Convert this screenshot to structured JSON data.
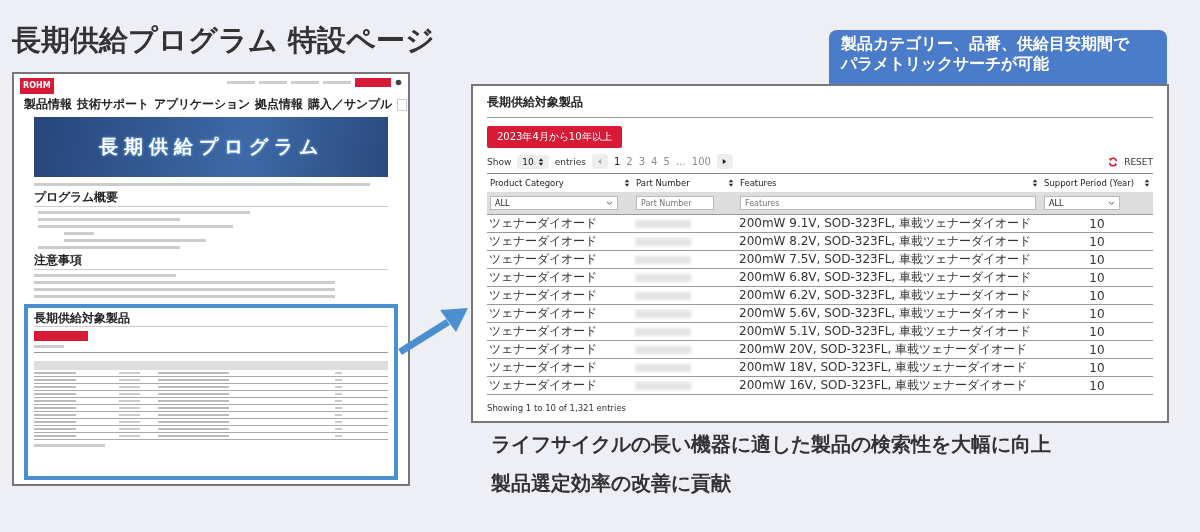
{
  "page_title": "長期供給プログラム 特設ページ",
  "callout": [
    "製品カテゴリー、品番、供給目安期間で",
    "パラメトリックサーチが可能"
  ],
  "thumbnail": {
    "logo": "ROHM",
    "nav": [
      "製品情報",
      "技術サポート",
      "アプリケーション",
      "拠点情報",
      "購入／サンプル"
    ],
    "banner_title": "長期供給プログラム",
    "headings": [
      "プログラム概要",
      "注意事項"
    ],
    "section_title": "長期供給対象製品"
  },
  "panel": {
    "title": "長期供給対象製品",
    "filter_button": "2023年4月から10年以上",
    "show_label": "Show",
    "page_size": "10",
    "entries_label": "entries",
    "pages": [
      {
        "label": "1",
        "selected": true
      },
      {
        "label": "2",
        "selected": false
      },
      {
        "label": "3",
        "selected": false
      },
      {
        "label": "4",
        "selected": false
      },
      {
        "label": "5",
        "selected": false
      },
      {
        "label": "…",
        "selected": false
      },
      {
        "label": "100",
        "selected": false
      }
    ],
    "reset": "RESET",
    "columns": [
      "Product Category",
      "Part Number",
      "Features",
      "Support Period (Year)"
    ],
    "filters": {
      "category": "ALL",
      "part_placeholder": "Part Number",
      "features_placeholder": "Features",
      "period": "ALL"
    },
    "rows": [
      {
        "category": "ツェナーダイオード",
        "features": "200mW 9.1V, SOD-323FL, 車載ツェナーダイオード",
        "period": "10"
      },
      {
        "category": "ツェナーダイオード",
        "features": "200mW 8.2V, SOD-323FL, 車載ツェナーダイオード",
        "period": "10"
      },
      {
        "category": "ツェナーダイオード",
        "features": "200mW 7.5V, SOD-323FL, 車載ツェナーダイオード",
        "period": "10"
      },
      {
        "category": "ツェナーダイオード",
        "features": "200mW 6.8V, SOD-323FL, 車載ツェナーダイオード",
        "period": "10"
      },
      {
        "category": "ツェナーダイオード",
        "features": "200mW 6.2V, SOD-323FL, 車載ツェナーダイオード",
        "period": "10"
      },
      {
        "category": "ツェナーダイオード",
        "features": "200mW 5.6V, SOD-323FL, 車載ツェナーダイオード",
        "period": "10"
      },
      {
        "category": "ツェナーダイオード",
        "features": "200mW 5.1V, SOD-323FL, 車載ツェナーダイオード",
        "period": "10"
      },
      {
        "category": "ツェナーダイオード",
        "features": "200mW 20V, SOD-323FL, 車載ツェナーダイオード",
        "period": "10"
      },
      {
        "category": "ツェナーダイオード",
        "features": "200mW 18V, SOD-323FL, 車載ツェナーダイオード",
        "period": "10"
      },
      {
        "category": "ツェナーダイオード",
        "features": "200mW 16V, SOD-323FL, 車載ツェナーダイオード",
        "period": "10"
      }
    ],
    "info": "Showing 1 to 10 of 1,321 entries"
  },
  "benefits": [
    "ライフサイクルの長い機器に適した製品の検索性を大幅に向上",
    "製品選定効率の改善に貢献"
  ]
}
